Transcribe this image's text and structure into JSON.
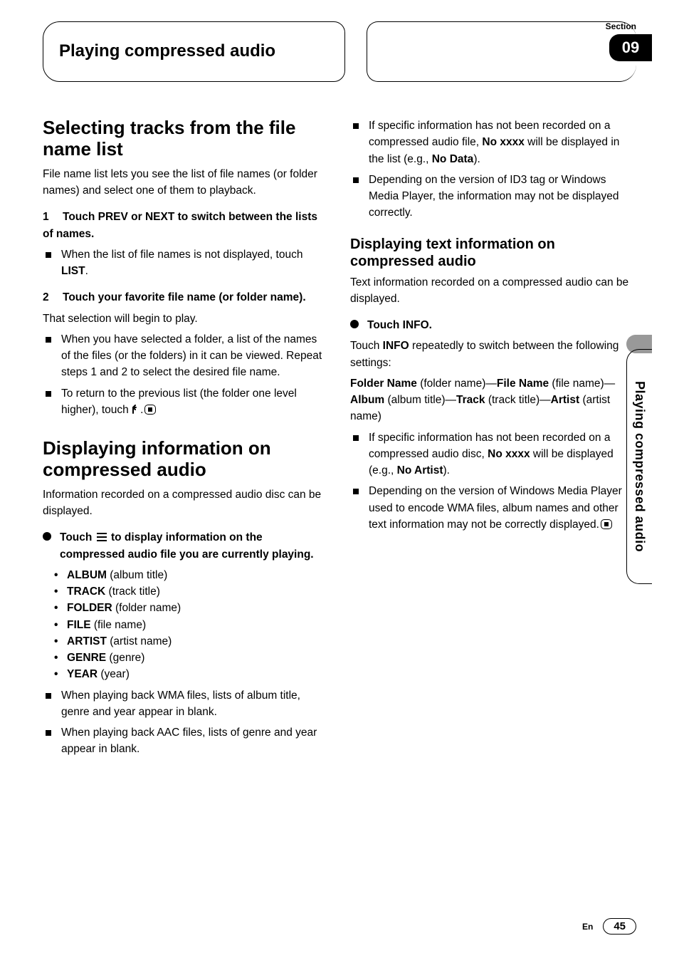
{
  "section_label": "Section",
  "section_number": "09",
  "chapter_title": "Playing compressed audio",
  "side_tab": "Playing compressed audio",
  "footer": {
    "lang": "En",
    "page": "45"
  },
  "left": {
    "h1": "Selecting tracks from the file name list",
    "p1": "File name list lets you see the list of file names (or folder names) and select one of them to playback.",
    "step1": {
      "num": "1",
      "text": "Touch PREV or NEXT to switch between the lists of names."
    },
    "step1_b1a": "When the list of file names is not displayed, touch ",
    "step1_b1b": "LIST",
    "step1_b1c": ".",
    "step2": {
      "num": "2",
      "text": "Touch your favorite file name (or folder name)."
    },
    "step2_p": "That selection will begin to play.",
    "step2_b1": "When you have selected a folder, a list of the names of the files (or the folders) in it can be viewed. Repeat steps 1 and 2 to select the desired file name.",
    "step2_b2a": "To return to the previous list (the folder one level higher), touch ",
    "step2_b2b": ".",
    "h2": "Displaying information on compressed audio",
    "p2": "Information recorded on a compressed audio disc can be displayed.",
    "cb1a": "Touch ",
    "cb1b": " to display information on the compressed audio file you are currently playing.",
    "items": [
      {
        "term": "ALBUM",
        "desc": " (album title)"
      },
      {
        "term": "TRACK",
        "desc": " (track title)"
      },
      {
        "term": "FOLDER",
        "desc": " (folder name)"
      },
      {
        "term": "FILE",
        "desc": " (file name)"
      },
      {
        "term": "ARTIST",
        "desc": " (artist name)"
      },
      {
        "term": "GENRE",
        "desc": " (genre)"
      },
      {
        "term": "YEAR",
        "desc": " (year)"
      }
    ],
    "b3": "When playing back WMA files, lists of album title, genre and year appear in blank.",
    "b4": "When playing back AAC files, lists of genre and year appear in blank."
  },
  "right": {
    "b1a": "If specific information has not been recorded on a compressed audio file, ",
    "b1b": "No xxxx",
    "b1c": " will be displayed in the list (e.g., ",
    "b1d": "No Data",
    "b1e": ").",
    "b2": "Depending on the version of ID3 tag or Windows Media Player, the information may not be displayed correctly.",
    "h3": "Displaying text information on compressed audio",
    "p3": "Text information recorded on a compressed audio can be displayed.",
    "cb2": "Touch INFO.",
    "p4a": "Touch ",
    "p4b": "INFO",
    "p4c": " repeatedly to switch between the following settings:",
    "seq": {
      "a": "Folder Name",
      "ad": " (folder name)—",
      "b": "File Name",
      "bd": " (file name)—",
      "c": "Album",
      "cd": " (album title)—",
      "d": "Track",
      "dd": " (track title)—",
      "e": "Artist",
      "ed": " (artist name)"
    },
    "b3a": "If specific information has not been recorded on a compressed audio disc, ",
    "b3b": "No xxxx",
    "b3c": " will be displayed (e.g., ",
    "b3d": "No Artist",
    "b3e": ").",
    "b4": "Depending on the version of Windows Media Player used to encode WMA files, album names and other text information may not be correctly displayed."
  }
}
